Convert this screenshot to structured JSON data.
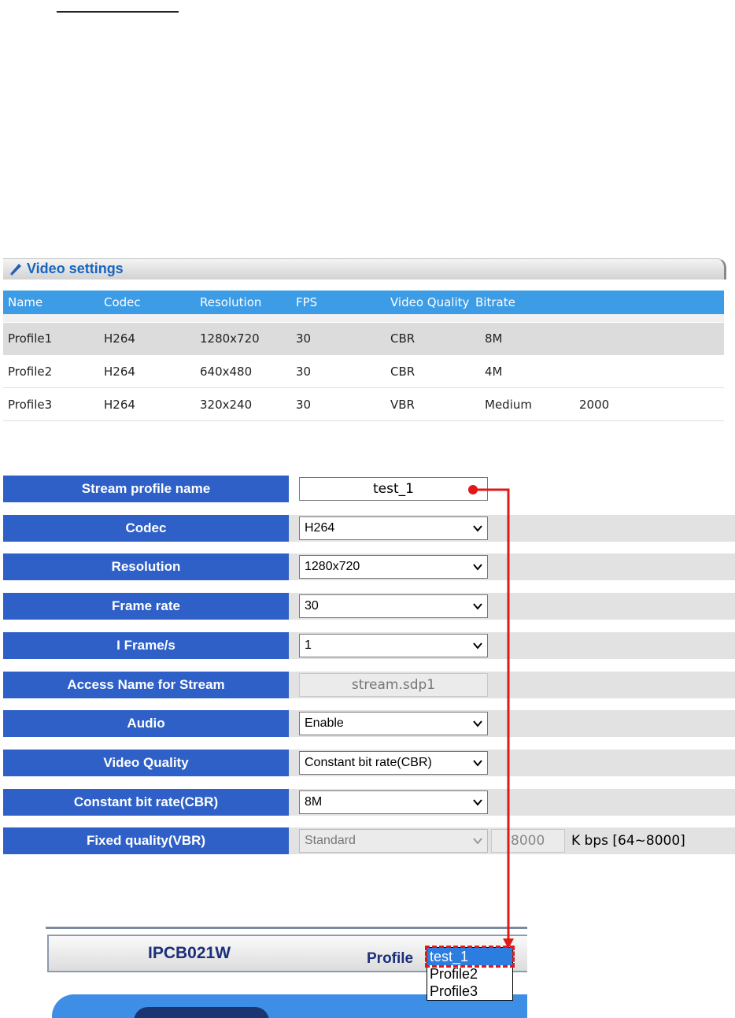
{
  "video_settings": {
    "title": "Video settings",
    "columns": [
      "Name",
      "Codec",
      "Resolution",
      "FPS",
      "Video Quality",
      "Bitrate"
    ],
    "rows": [
      [
        "Profile1",
        "H264",
        "1280x720",
        "30",
        "CBR",
        "8M",
        ""
      ],
      [
        "Profile2",
        "H264",
        "640x480",
        "30",
        "CBR",
        "4M",
        ""
      ],
      [
        "Profile3",
        "H264",
        "320x240",
        "30",
        "VBR",
        "Medium",
        "2000"
      ]
    ]
  },
  "form": {
    "stream_profile_name": {
      "label": "Stream profile name",
      "value": "test_1"
    },
    "codec": {
      "label": "Codec",
      "value": "H264"
    },
    "resolution": {
      "label": "Resolution",
      "value": "1280x720"
    },
    "frame_rate": {
      "label": "Frame rate",
      "value": "30"
    },
    "i_frame": {
      "label": "I Frame/s",
      "value": "1"
    },
    "access_name": {
      "label": "Access Name for Stream",
      "value": "stream.sdp1"
    },
    "audio": {
      "label": "Audio",
      "value": "Enable"
    },
    "video_quality": {
      "label": "Video Quality",
      "value": "Constant bit rate(CBR)"
    },
    "cbr": {
      "label": "Constant bit rate(CBR)",
      "value": "8M"
    },
    "vbr": {
      "label": "Fixed quality(VBR)",
      "value": "Standard",
      "bps_value": "8000",
      "bps_unit": "K bps [64~8000]"
    }
  },
  "viewer": {
    "model": "IPCB021W",
    "profile_label": "Profile",
    "profile_options": [
      "test_1",
      "Profile2",
      "Profile3"
    ]
  },
  "colors": {
    "label_bg": "#2e60c8",
    "table_header_bg": "#3c9ce6",
    "connector": "#e01818",
    "title_blue": "#1666c0"
  }
}
